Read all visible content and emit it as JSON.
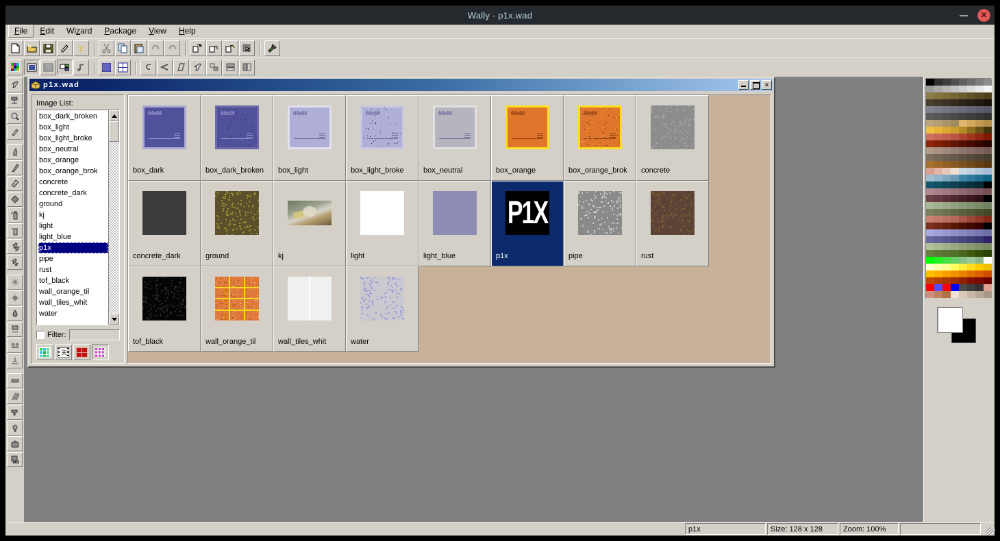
{
  "window": {
    "title": "Wally - p1x.wad",
    "minimize_label": "minimize",
    "close_label": "✕"
  },
  "menu": {
    "items": [
      {
        "label": "File",
        "accel": "F"
      },
      {
        "label": "Edit",
        "accel": "E"
      },
      {
        "label": "Wizard",
        "accel": "z"
      },
      {
        "label": "Package",
        "accel": "P"
      },
      {
        "label": "View",
        "accel": "V"
      },
      {
        "label": "Help",
        "accel": "H"
      }
    ]
  },
  "toolbar_top": {
    "buttons": [
      {
        "name": "new-file-button",
        "icon": "page-icon"
      },
      {
        "name": "open-file-button",
        "icon": "folder-open-icon"
      },
      {
        "name": "save-file-button",
        "icon": "floppy-disk-icon"
      },
      {
        "name": "print-button",
        "icon": "brush-icon"
      },
      {
        "name": "help-button",
        "icon": "question-mark-icon"
      },
      {
        "name": "cut-button",
        "icon": "scissors-icon"
      },
      {
        "name": "copy-button",
        "icon": "copy-icon"
      },
      {
        "name": "paste-button",
        "icon": "clipboard-icon"
      },
      {
        "name": "undo-button",
        "icon": "undo-arrow-icon"
      },
      {
        "name": "redo-button",
        "icon": "redo-arrow-icon"
      },
      {
        "name": "rotate-button",
        "icon": "rotate-icon"
      },
      {
        "name": "flip-button",
        "icon": "flip-icon"
      },
      {
        "name": "resize-button",
        "icon": "resize-icon"
      },
      {
        "name": "select-all-button",
        "icon": "cursor-box-icon"
      },
      {
        "name": "tools-button",
        "icon": "hammer-icon"
      }
    ]
  },
  "toolbar_second": {
    "buttons": [
      {
        "name": "palette-view-button",
        "icon": "color-palette-icon",
        "pressed": false
      },
      {
        "name": "image-view-button",
        "icon": "image-window-icon",
        "pressed": true
      },
      {
        "name": "mip-view-button",
        "icon": "grid-icon",
        "pressed": false
      },
      {
        "name": "thumbnail-view-button",
        "icon": "thumbnail-icon",
        "pressed": true
      },
      {
        "name": "sound-button",
        "icon": "music-note-icon",
        "pressed": false
      },
      {
        "name": "grid-fine-button",
        "icon": "fine-grid-icon",
        "pressed": false
      },
      {
        "name": "grid-coarse-button",
        "icon": "coarse-grid-icon",
        "pressed": false
      },
      {
        "name": "curve-button",
        "icon": "curve-icon",
        "pressed": false
      },
      {
        "name": "shrink-button",
        "icon": "arrow-left-icon",
        "pressed": false
      },
      {
        "name": "skew-button",
        "icon": "skew-icon",
        "pressed": false
      },
      {
        "name": "pick-button",
        "icon": "pointer-icon",
        "pressed": false
      },
      {
        "name": "align-button",
        "icon": "align-icon",
        "pressed": false
      },
      {
        "name": "tile-h-button",
        "icon": "tile-horizontal-icon",
        "pressed": false
      },
      {
        "name": "tile-v-button",
        "icon": "tile-vertical-icon",
        "pressed": false
      }
    ]
  },
  "left_tools": {
    "buttons": [
      {
        "name": "tool-select",
        "icon": "cursor-select-icon"
      },
      {
        "name": "tool-crop",
        "icon": "crop-icon"
      },
      {
        "name": "tool-zoom",
        "icon": "magnifier-icon"
      },
      {
        "name": "tool-pencil",
        "icon": "pencil-icon"
      },
      {
        "name": "tool-brush",
        "icon": "brush-stroke-icon"
      },
      {
        "name": "tool-line",
        "icon": "line-icon"
      },
      {
        "name": "tool-eraser",
        "icon": "eraser-icon"
      },
      {
        "name": "tool-fill",
        "icon": "paint-bucket-icon"
      },
      {
        "name": "tool-spray",
        "icon": "spray-can-icon"
      },
      {
        "name": "tool-airbrush",
        "icon": "airbrush-icon"
      },
      {
        "name": "tool-clone",
        "icon": "clone-icon"
      },
      {
        "name": "tool-smudge",
        "icon": "smudge-icon"
      },
      {
        "name": "tool-sharpen",
        "icon": "sparkle-icon"
      },
      {
        "name": "tool-brightness",
        "icon": "sun-icon"
      },
      {
        "name": "tool-droplet",
        "icon": "droplet-icon"
      },
      {
        "name": "tool-noise",
        "icon": "noise-icon"
      },
      {
        "name": "tool-blur",
        "icon": "blur-icon"
      },
      {
        "name": "tool-stamp",
        "icon": "stamp-icon"
      },
      {
        "name": "tool-rectangle",
        "icon": "rectangle-icon"
      },
      {
        "name": "tool-hatch",
        "icon": "hatch-lines-icon"
      },
      {
        "name": "tool-warp",
        "icon": "warp-gun-icon"
      },
      {
        "name": "tool-bulb",
        "icon": "light-bulb-icon"
      },
      {
        "name": "tool-case",
        "icon": "toolbox-icon"
      },
      {
        "name": "tool-layers",
        "icon": "layers-icon"
      }
    ]
  },
  "child_window": {
    "title": "p1x.wad",
    "icon": "wad-package-icon",
    "buttons": {
      "minimize": "_",
      "maximize": "□",
      "close": "✕"
    }
  },
  "image_list": {
    "label": "Image List:",
    "items": [
      "box_dark_broken",
      "box_light",
      "box_light_broke",
      "box_neutral",
      "box_orange",
      "box_orange_brok",
      "concrete",
      "concrete_dark",
      "ground",
      "kj",
      "light",
      "light_blue",
      "p1x",
      "pipe",
      "rust",
      "tof_black",
      "wall_orange_til",
      "wall_tiles_whit",
      "water"
    ],
    "selected": "p1x",
    "filter": {
      "label": "Filter:",
      "checked": false,
      "value": "",
      "placeholder": ""
    },
    "view_buttons": [
      {
        "name": "view-mode-palette",
        "icon": "checker-color-icon",
        "pressed": false
      },
      {
        "name": "view-mode-filmstrip",
        "icon": "filmstrip-icon",
        "pressed": false
      },
      {
        "name": "view-mode-large-tiles",
        "icon": "large-tiles-icon",
        "pressed": false
      },
      {
        "name": "view-mode-grid",
        "icon": "grid-tiles-icon",
        "pressed": true
      }
    ]
  },
  "thumbnails": [
    {
      "name": "box_dark",
      "kind": "box",
      "fill": "#51509a",
      "border": "#aaa9d4",
      "text": "#9a9ad0",
      "size_label": "64x64",
      "broken": false
    },
    {
      "name": "box_dark_broken",
      "kind": "box",
      "fill": "#51509a",
      "border": "#6c6ba8",
      "text": "#9a9ad0",
      "size_label": "64x64",
      "broken": true
    },
    {
      "name": "box_light",
      "kind": "box",
      "fill": "#aeaed6",
      "border": "#e2e0ef",
      "text": "#6a6a9e",
      "size_label": "64x64",
      "broken": false
    },
    {
      "name": "box_light_broke",
      "kind": "box",
      "fill": "#aeaed6",
      "border": "#c9c8e0",
      "text": "#6a6a9e",
      "size_label": "64x64",
      "broken": true
    },
    {
      "name": "box_neutral",
      "kind": "box",
      "fill": "#b6b5bd",
      "border": "#e0dfe3",
      "text": "#6a6a9e",
      "size_label": "64x64",
      "broken": false
    },
    {
      "name": "box_orange",
      "kind": "box",
      "fill": "#e0762c",
      "border": "#fcdf20",
      "text": "#8c3a10",
      "size_label": "64x64",
      "broken": false
    },
    {
      "name": "box_orange_brok",
      "kind": "box",
      "fill": "#e0762c",
      "border": "#fcdf20",
      "text": "#8c3a10",
      "size_label": "64x64",
      "broken": true
    },
    {
      "name": "concrete",
      "kind": "noise",
      "fill": "#8c8c8c",
      "speck": "#a2a2a2"
    },
    {
      "name": "concrete_dark",
      "kind": "solid",
      "fill": "#3c3c3c"
    },
    {
      "name": "ground",
      "kind": "noise",
      "fill": "#5d4f2b",
      "speck": "#8f9434"
    },
    {
      "name": "kj",
      "kind": "photo",
      "fill": "#8d8f83"
    },
    {
      "name": "light",
      "kind": "solid",
      "fill": "#ffffff"
    },
    {
      "name": "light_blue",
      "kind": "solid",
      "fill": "#8c8cb4"
    },
    {
      "name": "p1x",
      "kind": "logo",
      "fill": "#000000",
      "logo_text": "P1X",
      "selected": true
    },
    {
      "name": "pipe",
      "kind": "noise",
      "fill": "#8a8a8a",
      "speck": "#c8c8c8"
    },
    {
      "name": "rust",
      "kind": "noise",
      "fill": "#5b4436",
      "speck": "#7d5a34"
    },
    {
      "name": "tof_black",
      "kind": "noise",
      "fill": "#050505",
      "speck": "#2a2a2a"
    },
    {
      "name": "wall_orange_til",
      "kind": "tiles",
      "fill": "#e07a3c",
      "grout": "#f5dc1e",
      "cols": 3,
      "rows": 4
    },
    {
      "name": "wall_tiles_whit",
      "kind": "tiles",
      "fill": "#f0f0ef",
      "grout": "#ffffff",
      "cols": 2,
      "rows": 1
    },
    {
      "name": "water",
      "kind": "noise",
      "fill": "#c9c9cf",
      "speck": "#9a9ad6"
    }
  ],
  "palette": {
    "columns": 8,
    "colors": [
      "#000000",
      "#2e2e2e",
      "#3d3d3d",
      "#4f4f4f",
      "#5f5f5f",
      "#6e6e6e",
      "#7e7e7e",
      "#8d8d8d",
      "#9c9c9c",
      "#a9a9a9",
      "#b6b6b6",
      "#c2c2c2",
      "#cfcfcf",
      "#dcdcdc",
      "#e9e9e9",
      "#f5f5f5",
      "#8c7c4a",
      "#86753f",
      "#7e6d3b",
      "#756434",
      "#6b5a2e",
      "#625228",
      "#584922",
      "#4f411d",
      "#4a4030",
      "#423829",
      "#3b3124",
      "#342b1f",
      "#2d2519",
      "#261f14",
      "#1f190f",
      "#18130a",
      "#81818f",
      "#7b7b8a",
      "#757584",
      "#6f6f7e",
      "#696978",
      "#636372",
      "#5d5d6c",
      "#575766",
      "#5b5b5b",
      "#555555",
      "#4f4f4f",
      "#494949",
      "#434343",
      "#3d3d3d",
      "#373737",
      "#313131",
      "#bba67b",
      "#b49e72",
      "#ab9469",
      "#a38b60",
      "#e0b46b",
      "#d2a75e",
      "#c49a52",
      "#b68d46",
      "#f0c040",
      "#e8b43a",
      "#dba834",
      "#cd9c2e",
      "#b48a27",
      "#8f6d1f",
      "#6a5117",
      "#45350f",
      "#d07060",
      "#c96757",
      "#c25e4e",
      "#bb5545",
      "#ad4532",
      "#9e3620",
      "#8f2710",
      "#801800",
      "#8e2408",
      "#7f1f06",
      "#701a05",
      "#611503",
      "#521002",
      "#430b01",
      "#340700",
      "#250300",
      "#b09a8a",
      "#a89183",
      "#a0887c",
      "#987f75",
      "#8f766d",
      "#876d66",
      "#7f645f",
      "#775b58",
      "#7d6e5e",
      "#756757",
      "#6d6050",
      "#655949",
      "#5d5242",
      "#554b3b",
      "#4d4434",
      "#453d2d",
      "#a8702c",
      "#9d6828",
      "#926024",
      "#875820",
      "#7c501c",
      "#714818",
      "#664014",
      "#5b3810",
      "#d8a090",
      "#e0b4a6",
      "#e8c8bc",
      "#f0dcd2",
      "#ccd8e4",
      "#bfcfe0",
      "#b2c6dc",
      "#a5bdd8",
      "#a0c0d0",
      "#90b4c8",
      "#80a8c0",
      "#6a9ab4",
      "#3f85a8",
      "#2f7a9c",
      "#1f6f90",
      "#0f6484",
      "#14586e",
      "#125064",
      "#10485a",
      "#0e4050",
      "#0c3846",
      "#0a303c",
      "#082832",
      "#000000",
      "#b08890",
      "#a88088",
      "#a07880",
      "#987078",
      "#906870",
      "#886068",
      "#805860",
      "#785058",
      "#6e4048",
      "#643840",
      "#5a3038",
      "#502830",
      "#462028",
      "#3c1820",
      "#321018",
      "#000000",
      "#aab89a",
      "#a2b092",
      "#9aa88a",
      "#92a082",
      "#8a987a",
      "#829072",
      "#7a886a",
      "#728062",
      "#7a8060",
      "#727858",
      "#6a7050",
      "#626848",
      "#5a6040",
      "#525838",
      "#4a5030",
      "#424828",
      "#cc8070",
      "#c47868",
      "#bc7060",
      "#b46858",
      "#a85848",
      "#9c4838",
      "#903828",
      "#842818",
      "#7c3020",
      "#702818",
      "#642010",
      "#581808",
      "#4c1000",
      "#400800",
      "#340000",
      "#000000",
      "#a8a8e0",
      "#a0a0d8",
      "#9898d0",
      "#9090c8",
      "#8888c0",
      "#8080b8",
      "#7878b0",
      "#7070a8",
      "#6868a0",
      "#606098",
      "#585890",
      "#505088",
      "#484880",
      "#404078",
      "#383870",
      "#302068",
      "#b0c098",
      "#a8b890",
      "#a0b088",
      "#98a880",
      "#90a078",
      "#889870",
      "#809068",
      "#788860",
      "#6a8040",
      "#627838",
      "#5a7030",
      "#527028",
      "#4a6820",
      "#3f5a0f",
      "#344c08",
      "#294000",
      "#00ff00",
      "#22f022",
      "#44e044",
      "#66d066",
      "#88c088",
      "#9ac89a",
      "#8ab88a",
      "#ffffff",
      "#ffffd0",
      "#ffffb0",
      "#ffff90",
      "#ffff60",
      "#ffee40",
      "#ffdc20",
      "#ffcc00",
      "#f0c000",
      "#ffc000",
      "#ffb000",
      "#f8a000",
      "#f09000",
      "#e88000",
      "#e07000",
      "#d86000",
      "#d05000",
      "#c04800",
      "#b44000",
      "#a83800",
      "#9c3000",
      "#902000",
      "#841000",
      "#780800",
      "#6c0000",
      "#ff0000",
      "#5050ff",
      "#ff0000",
      "#0000ff",
      "#4a4a4a",
      "#3e3e3e",
      "#323232",
      "#e0a090",
      "#d09080",
      "#c08060",
      "#b07040",
      "#f0e0d8",
      "#d8c8b8",
      "#c8b8a8",
      "#b8a898",
      "#a89888"
    ],
    "foreground": "#ffffff",
    "background": "#000000"
  },
  "status_bar": {
    "name": "p1x",
    "size": "Size: 128 x 128",
    "zoom": "Zoom: 100%",
    "extra": ""
  }
}
